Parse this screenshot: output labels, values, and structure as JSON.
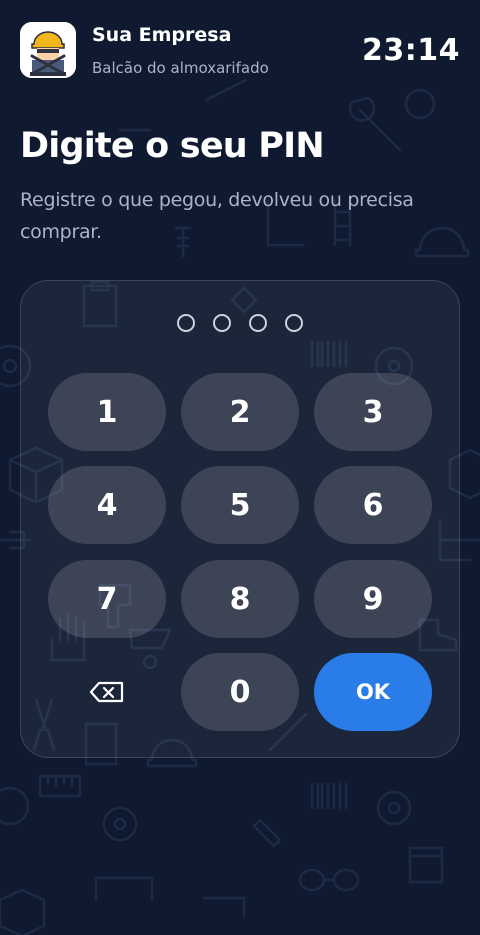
{
  "header": {
    "company_name": "Sua Empresa",
    "company_subtitle": "Balcão do almoxarifado",
    "time": "23:14"
  },
  "title": "Digite o seu PIN",
  "subtitle": "Registre o que pegou, devolveu ou precisa comprar.",
  "pin": {
    "length": 4,
    "filled": 0
  },
  "keypad": {
    "keys": [
      "1",
      "2",
      "3",
      "4",
      "5",
      "6",
      "7",
      "8",
      "9",
      "0"
    ],
    "backspace_icon": "backspace-icon",
    "ok_label": "OK"
  },
  "colors": {
    "background": "#0f1a30",
    "accent": "#2a7de8",
    "text_secondary": "#aab4c4"
  }
}
